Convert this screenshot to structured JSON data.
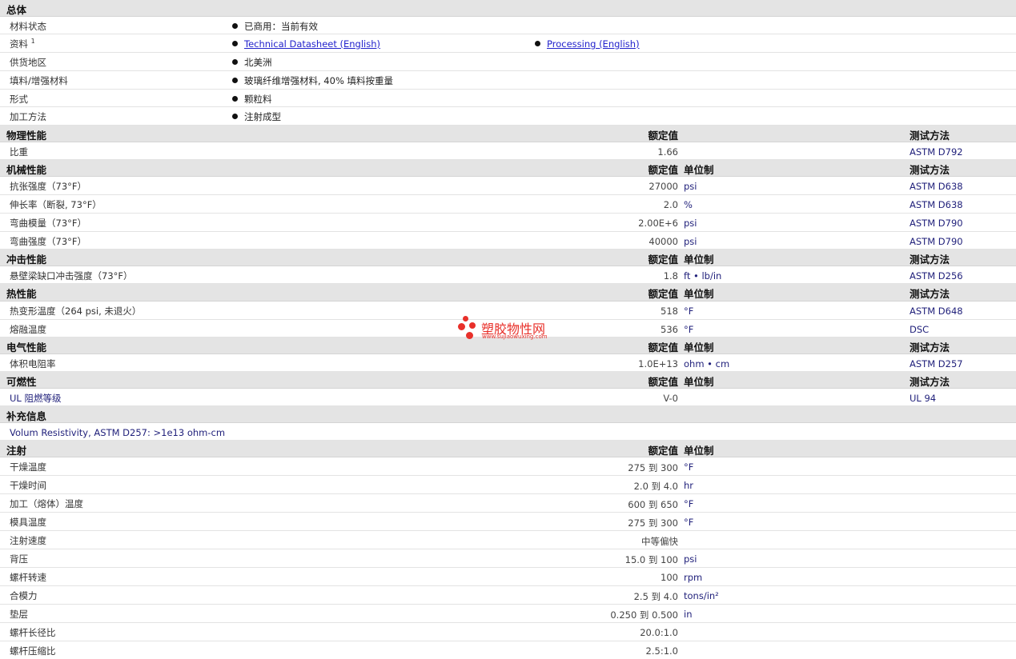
{
  "general": {
    "title": "总体",
    "status": {
      "label": "材料状态",
      "value": "已商用：当前有效"
    },
    "docs": {
      "label": "资料",
      "sup": "1",
      "link1": "Technical Datasheet (English)",
      "link2": "Processing (English)"
    },
    "region": {
      "label": "供货地区",
      "value": "北美洲"
    },
    "filler": {
      "label": "填料/增强材料",
      "value": "玻璃纤维增强材料, 40% 填料按重量"
    },
    "form": {
      "label": "形式",
      "value": "颗粒料"
    },
    "method": {
      "label": "加工方法",
      "value": "注射成型"
    }
  },
  "headers": {
    "nominal": "额定值",
    "unit": "单位制",
    "test": "测试方法"
  },
  "physical": {
    "title": "物理性能",
    "rows": [
      {
        "label": "比重",
        "value": "1.66",
        "unit": "",
        "method": "ASTM D792"
      }
    ]
  },
  "mechanical": {
    "title": "机械性能",
    "rows": [
      {
        "label": "抗张强度（73°F）",
        "value": "27000",
        "unit": "psi",
        "method": "ASTM D638"
      },
      {
        "label": "伸长率（断裂, 73°F）",
        "value": "2.0",
        "unit": "%",
        "method": "ASTM D638"
      },
      {
        "label": "弯曲模量（73°F）",
        "value": "2.00E+6",
        "unit": "psi",
        "method": "ASTM D790"
      },
      {
        "label": "弯曲强度（73°F）",
        "value": "40000",
        "unit": "psi",
        "method": "ASTM D790"
      }
    ]
  },
  "impact": {
    "title": "冲击性能",
    "rows": [
      {
        "label": "悬壁梁缺口冲击强度（73°F）",
        "value": "1.8",
        "unit": "ft • lb/in",
        "method": "ASTM D256"
      }
    ]
  },
  "thermal": {
    "title": "热性能",
    "rows": [
      {
        "label": "热变形温度（264 psi, 未退火）",
        "value": "518",
        "unit": "°F",
        "method": "ASTM D648"
      },
      {
        "label": "熔融温度",
        "value": "536",
        "unit": "°F",
        "method": "DSC"
      }
    ]
  },
  "electrical": {
    "title": "电气性能",
    "rows": [
      {
        "label": "体积电阻率",
        "value": "1.0E+13",
        "unit": "ohm • cm",
        "method": "ASTM D257"
      }
    ]
  },
  "flammability": {
    "title": "可燃性",
    "rows": [
      {
        "label": "UL 阻燃等级",
        "value": "V-0",
        "unit": "",
        "method": "UL 94"
      }
    ]
  },
  "supplement": {
    "title": "补充信息",
    "note": "Volum Resistivity, ASTM D257: >1e13 ohm-cm"
  },
  "injection": {
    "title": "注射",
    "rows": [
      {
        "label": "干燥温度",
        "value": "275 到 300",
        "unit": "°F"
      },
      {
        "label": "干燥时间",
        "value": "2.0 到 4.0",
        "unit": "hr"
      },
      {
        "label": "加工（熔体）温度",
        "value": "600 到 650",
        "unit": "°F"
      },
      {
        "label": "模具温度",
        "value": "275 到 300",
        "unit": "°F"
      },
      {
        "label": "注射速度",
        "value": "中等偏快",
        "unit": ""
      },
      {
        "label": "背压",
        "value": "15.0 到 100",
        "unit": "psi"
      },
      {
        "label": "螺杆转速",
        "value": "100",
        "unit": "rpm"
      },
      {
        "label": "合模力",
        "value": "2.5 到 4.0",
        "unit": "tons/in²"
      },
      {
        "label": "垫层",
        "value": "0.250 到 0.500",
        "unit": "in"
      },
      {
        "label": "螺杆长径比",
        "value": "20.0:1.0",
        "unit": ""
      },
      {
        "label": "螺杆压缩比",
        "value": "2.5:1.0",
        "unit": ""
      }
    ]
  },
  "watermark": {
    "cn": "塑胶物性网",
    "en": "www.sujiaowuxing.com"
  },
  "colors": {
    "section_bg": "#e4e4e4",
    "text_blue": "#1f1f7a",
    "link": "#2222cc",
    "watermark": "#e8302a"
  }
}
